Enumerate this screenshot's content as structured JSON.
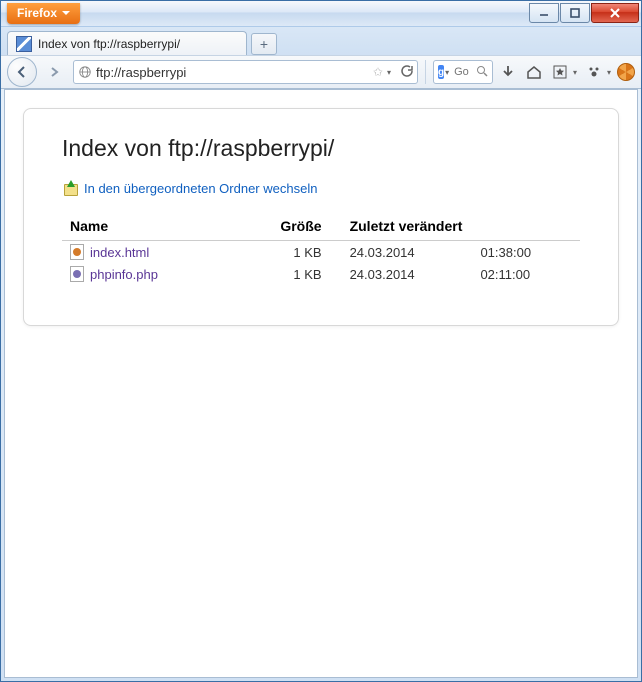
{
  "window": {
    "app_menu_label": "Firefox"
  },
  "tab": {
    "title": "Index von ftp://raspberrypi/"
  },
  "toolbar": {
    "url": "ftp://raspberrypi",
    "search_engine_badge": "g",
    "search_placeholder": "Go"
  },
  "page": {
    "heading": "Index von ftp://raspberrypi/",
    "up_link": "In den übergeordneten Ordner wechseln",
    "columns": {
      "name": "Name",
      "size": "Größe",
      "modified": "Zuletzt verändert"
    },
    "files": [
      {
        "name": "index.html",
        "size": "1 KB",
        "date": "24.03.2014",
        "time": "01:38:00",
        "type": "html"
      },
      {
        "name": "phpinfo.php",
        "size": "1 KB",
        "date": "24.03.2014",
        "time": "02:11:00",
        "type": "php"
      }
    ]
  }
}
